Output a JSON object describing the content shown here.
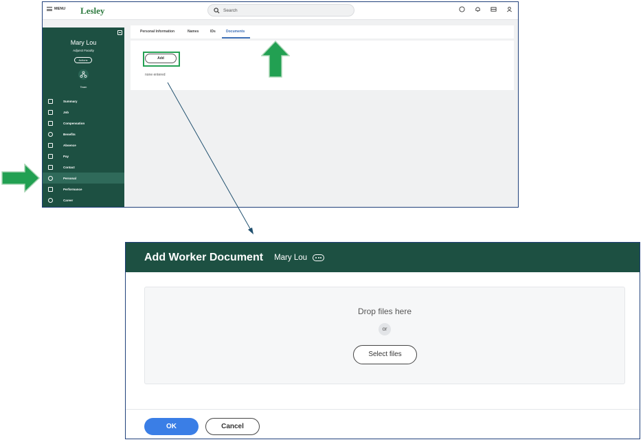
{
  "topbar": {
    "menu_label": "MENU",
    "logo_text": "Lesley",
    "search_placeholder": "Search",
    "icons": [
      "chat-icon",
      "bell-icon",
      "inbox-icon",
      "profile-icon"
    ]
  },
  "sidebar": {
    "name": "Mary Lou",
    "role": "Adjunct Faculty",
    "actions_label": "Actions",
    "team_label": "Team",
    "items": [
      {
        "label": "Summary",
        "icon": "summary-icon"
      },
      {
        "label": "Job",
        "icon": "briefcase-icon"
      },
      {
        "label": "Compensation",
        "icon": "compensation-icon"
      },
      {
        "label": "Benefits",
        "icon": "shield-icon"
      },
      {
        "label": "Absence",
        "icon": "absence-icon"
      },
      {
        "label": "Pay",
        "icon": "wallet-icon"
      },
      {
        "label": "Contact",
        "icon": "contact-icon"
      },
      {
        "label": "Personal",
        "icon": "person-icon"
      },
      {
        "label": "Performance",
        "icon": "performance-icon"
      },
      {
        "label": "Career",
        "icon": "career-icon"
      }
    ],
    "active_item": "Personal"
  },
  "tabs": [
    {
      "label": "Personal Information"
    },
    {
      "label": "Names"
    },
    {
      "label": "IDs"
    },
    {
      "label": "Documents"
    }
  ],
  "active_tab": "Documents",
  "documents": {
    "add_label": "Add",
    "empty_text": "none entered"
  },
  "dialog": {
    "title": "Add Worker Document",
    "subtitle": "Mary Lou",
    "drop_text": "Drop files here",
    "or_text": "or",
    "select_label": "Select files",
    "ok_label": "OK",
    "cancel_label": "Cancel"
  },
  "colors": {
    "brand_green": "#1d5042",
    "highlight_green": "#22a052",
    "primary_blue": "#3a7ee6",
    "tab_blue": "#3d6fb6",
    "connector_blue": "#1f4f6e"
  }
}
